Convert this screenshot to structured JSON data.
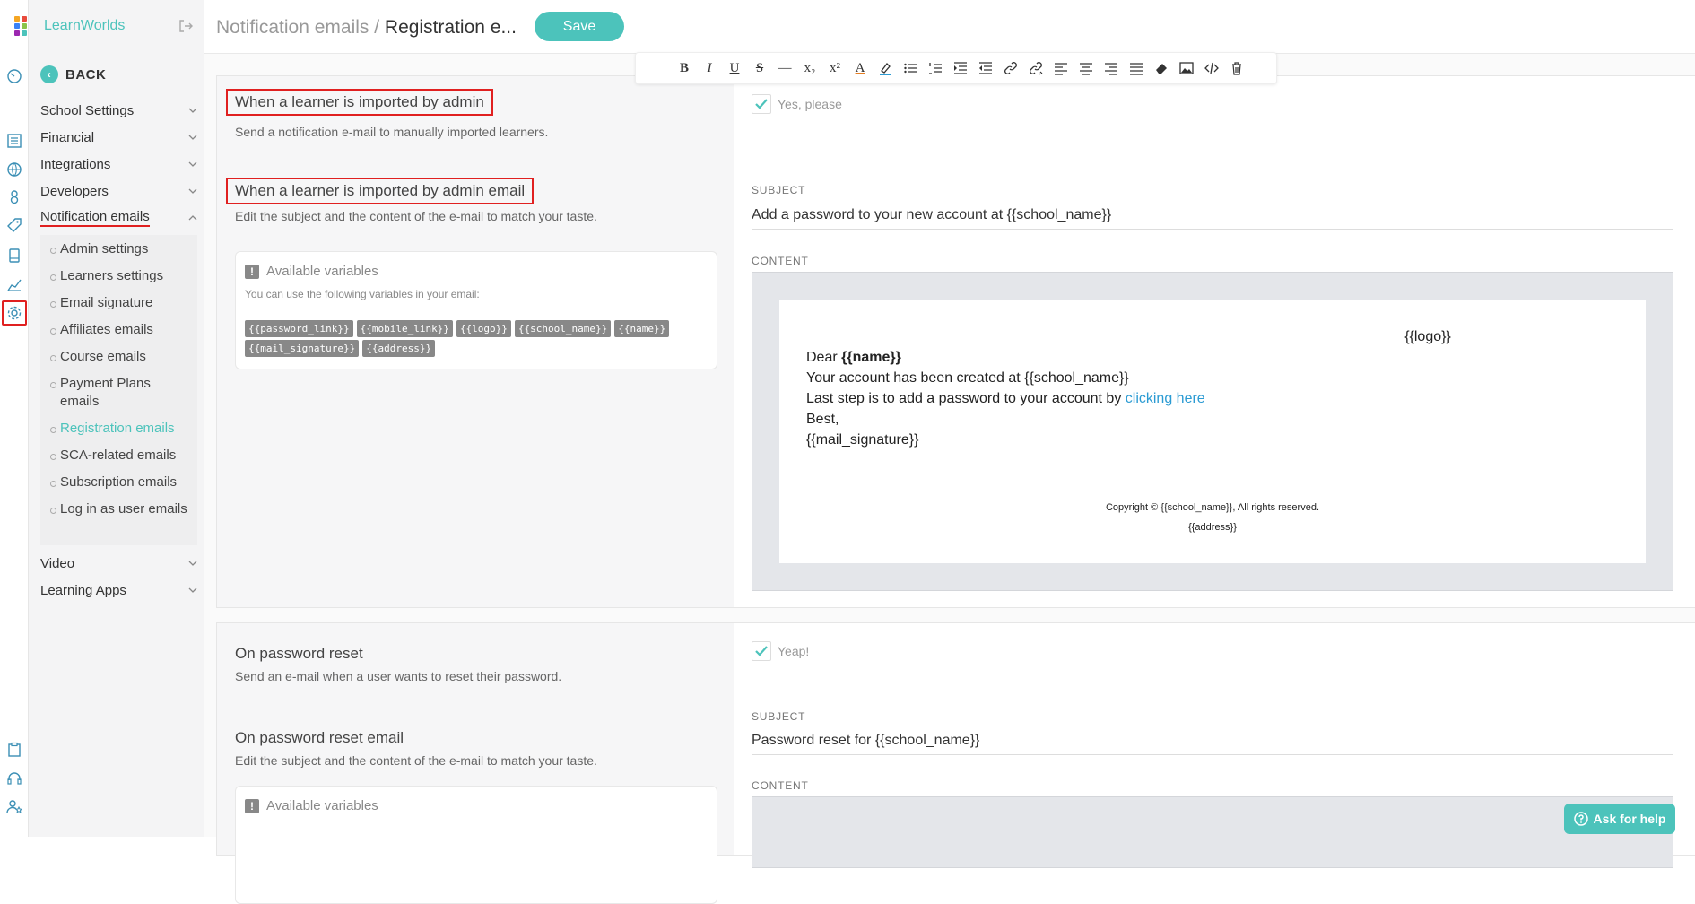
{
  "app": {
    "brand": "LearnWorlds"
  },
  "header": {
    "crumb_parent": "Notification emails / ",
    "crumb_current": "Registration e...",
    "save_label": "Save"
  },
  "sidebar": {
    "back_label": "BACK",
    "items": [
      {
        "label": "School Settings"
      },
      {
        "label": "Financial"
      },
      {
        "label": "Integrations"
      },
      {
        "label": "Developers"
      },
      {
        "label": "Notification emails"
      },
      {
        "label": "Video"
      },
      {
        "label": "Learning Apps"
      }
    ],
    "subitems": [
      {
        "label": "Admin settings"
      },
      {
        "label": "Learners settings"
      },
      {
        "label": "Email signature"
      },
      {
        "label": "Affiliates emails"
      },
      {
        "label": "Course emails"
      },
      {
        "label": "Payment Plans emails"
      },
      {
        "label": "Registration emails"
      },
      {
        "label": "SCA-related emails"
      },
      {
        "label": "Subscription emails"
      },
      {
        "label": "Log in as user emails"
      }
    ]
  },
  "toolbar": {
    "bold": "B",
    "italic": "I",
    "underline": "U",
    "strike": "S",
    "hr": "—",
    "sub": "x₂",
    "sup": "x²",
    "font_color": "A"
  },
  "section1": {
    "toggle_title": "When a learner is imported by admin",
    "toggle_desc": "Send a notification e-mail to manually imported learners.",
    "toggle_label": "Yes, please",
    "email_title": "When a learner is imported by admin email",
    "email_desc": "Edit the subject and the content of the e-mail to match your taste.",
    "vars_title": "Available variables",
    "vars_note": "You can use the following variables in your email:",
    "variables": [
      "{{password_link}}",
      "{{mobile_link}}",
      "{{logo}}",
      "{{school_name}}",
      "{{name}}",
      "{{mail_signature}}",
      "{{address}}"
    ],
    "subject_label": "SUBJECT",
    "subject_value": "Add a password to your new account at {{school_name}}",
    "content_label": "CONTENT",
    "email": {
      "logo": "{{logo}}",
      "dear": "Dear ",
      "name": "{{name}}",
      "line1": "Your account has been created at {{school_name}}",
      "line2_prefix": "Last step is to add a password to your account by ",
      "line2_link": "clicking here",
      "best": "Best,",
      "signature": "{{mail_signature}}",
      "copyright": "Copyright © {{school_name}}, All rights reserved.",
      "address": "{{address}}"
    }
  },
  "section2": {
    "toggle_title": "On password reset",
    "toggle_desc": "Send an e-mail when a user wants to reset their password.",
    "toggle_label": "Yeap!",
    "email_title": "On password reset email",
    "email_desc": "Edit the subject and the content of the e-mail to match your taste.",
    "vars_title": "Available variables",
    "subject_label": "SUBJECT",
    "subject_value": "Password reset for {{school_name}}",
    "content_label": "CONTENT"
  },
  "help": {
    "label": "Ask for help"
  },
  "colors": {
    "accent": "#4cc3bb",
    "highlight": "#e02020",
    "link": "#2b9bd3"
  }
}
